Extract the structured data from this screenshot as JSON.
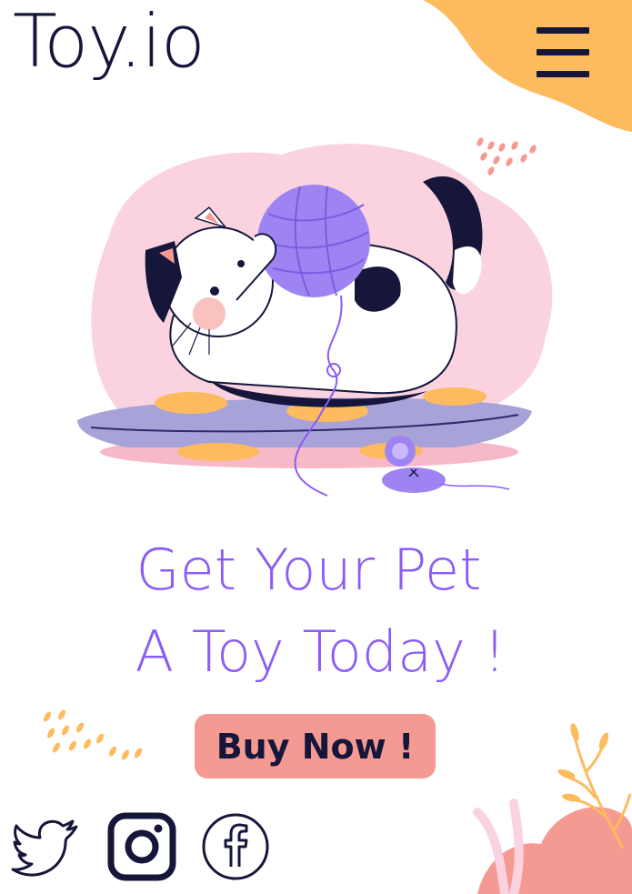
{
  "header": {
    "logo_text": "Toy.io",
    "menu_icon": "hamburger-menu-icon"
  },
  "hero": {
    "illustration": "cat-with-yarn-illustration",
    "headline_line1": "Get Your Pet",
    "headline_line2": "A Toy Today !",
    "cta_label": "Buy Now !"
  },
  "social": {
    "items": [
      {
        "icon": "twitter-icon"
      },
      {
        "icon": "instagram-icon"
      },
      {
        "icon": "facebook-icon"
      }
    ]
  },
  "colors": {
    "accent_purple": "#8b5cf6",
    "cta_pink": "#f59a93",
    "dark_navy": "#15163a",
    "orange": "#fdbb5e"
  }
}
